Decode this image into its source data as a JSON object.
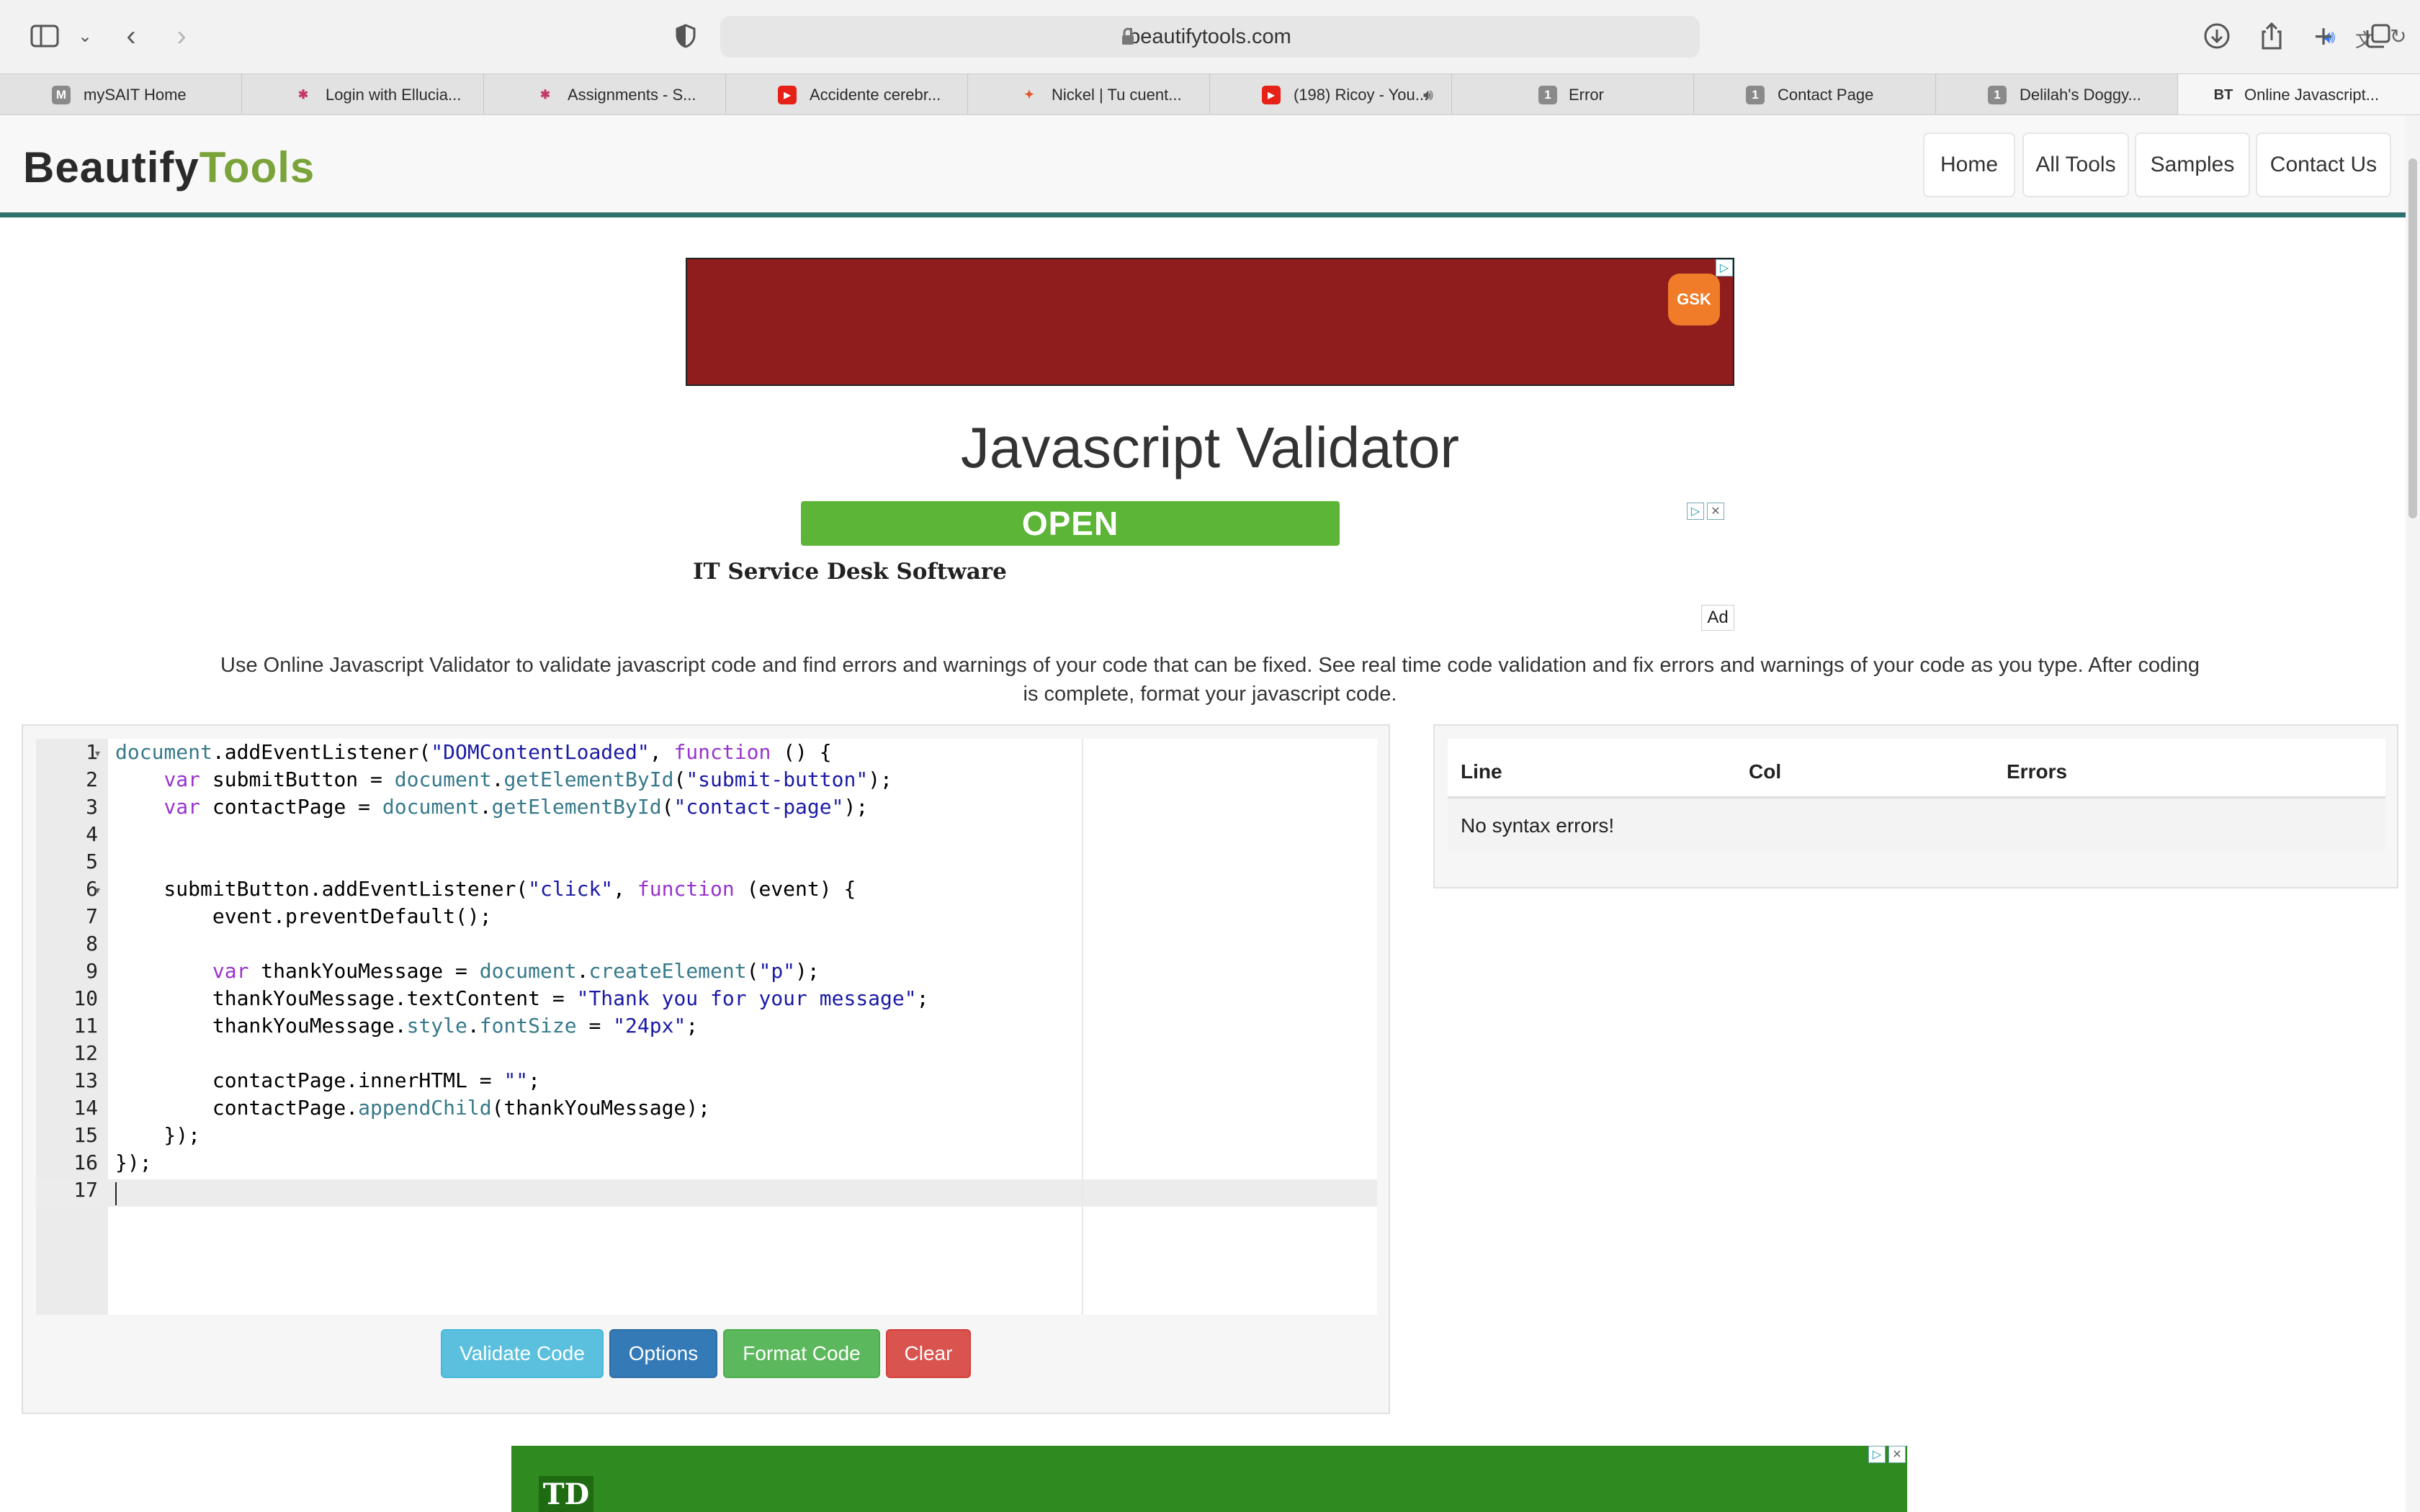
{
  "browser": {
    "url": "beautifytools.com",
    "tabs": [
      {
        "label": "mySAIT Home",
        "favicon": "M",
        "color": "#8a8a8a"
      },
      {
        "label": "Login with Ellucia...",
        "favicon": "✱",
        "color": "#c23a6b"
      },
      {
        "label": "Assignments - S...",
        "favicon": "✱",
        "color": "#c23a6b"
      },
      {
        "label": "Accidente cerebr...",
        "favicon": "▶",
        "color": "#e62117"
      },
      {
        "label": "Nickel | Tu cuent...",
        "favicon": "✦",
        "color": "#e4572e"
      },
      {
        "label": "(198) Ricoy - You...",
        "favicon": "▶",
        "color": "#e62117"
      },
      {
        "label": "Error",
        "favicon": "1",
        "color": "#8a8a8a"
      },
      {
        "label": "Contact Page",
        "favicon": "1",
        "color": "#8a8a8a"
      },
      {
        "label": "Delilah's Doggy...",
        "favicon": "1",
        "color": "#8a8a8a"
      },
      {
        "label": "Online Javascript...",
        "favicon": "BT",
        "color": "#333333"
      }
    ]
  },
  "site": {
    "logo_part1": "Beautify",
    "logo_part2": "Tools",
    "nav": [
      "Home",
      "All Tools",
      "Samples",
      "Contact Us"
    ]
  },
  "ads": {
    "top_brand": "GSK",
    "open_label": "OPEN",
    "service_text": "IT Service Desk Software",
    "ad_tag": "Ad",
    "bottom_brand": "TD"
  },
  "page": {
    "title": "Javascript Validator",
    "description": "Use Online Javascript Validator to validate javascript code and find errors and warnings of your code that can be fixed. See real time code validation and fix errors and warnings of your code as you type. After coding is complete, format your javascript code."
  },
  "editor": {
    "line_numbers": [
      "1",
      "2",
      "3",
      "4",
      "5",
      "6",
      "7",
      "8",
      "9",
      "10",
      "11",
      "12",
      "13",
      "14",
      "15",
      "16",
      "17"
    ],
    "lines": [
      "document.addEventListener(\"DOMContentLoaded\", function () {",
      "    var submitButton = document.getElementById(\"submit-button\");",
      "    var contactPage = document.getElementById(\"contact-page\");",
      "",
      "",
      "    submitButton.addEventListener(\"click\", function (event) {",
      "        event.preventDefault();",
      "",
      "        var thankYouMessage = document.createElement(\"p\");",
      "        thankYouMessage.textContent = \"Thank you for your message\";",
      "        thankYouMessage.style.fontSize = \"24px\";",
      "",
      "        contactPage.innerHTML = \"\";",
      "        contactPage.appendChild(thankYouMessage);",
      "    });",
      "});",
      ""
    ],
    "buttons": {
      "validate": "Validate Code",
      "options": "Options",
      "format": "Format Code",
      "clear": "Clear"
    }
  },
  "results": {
    "headers": [
      "Line",
      "Col",
      "Errors"
    ],
    "message": "No syntax errors!"
  },
  "colors": {
    "accent": "#2e6f6f",
    "logo_green": "#7aa43a",
    "validate_btn": "#5bc0de",
    "options_btn": "#337ab7",
    "format_btn": "#5cb85c",
    "clear_btn": "#d9534f"
  }
}
